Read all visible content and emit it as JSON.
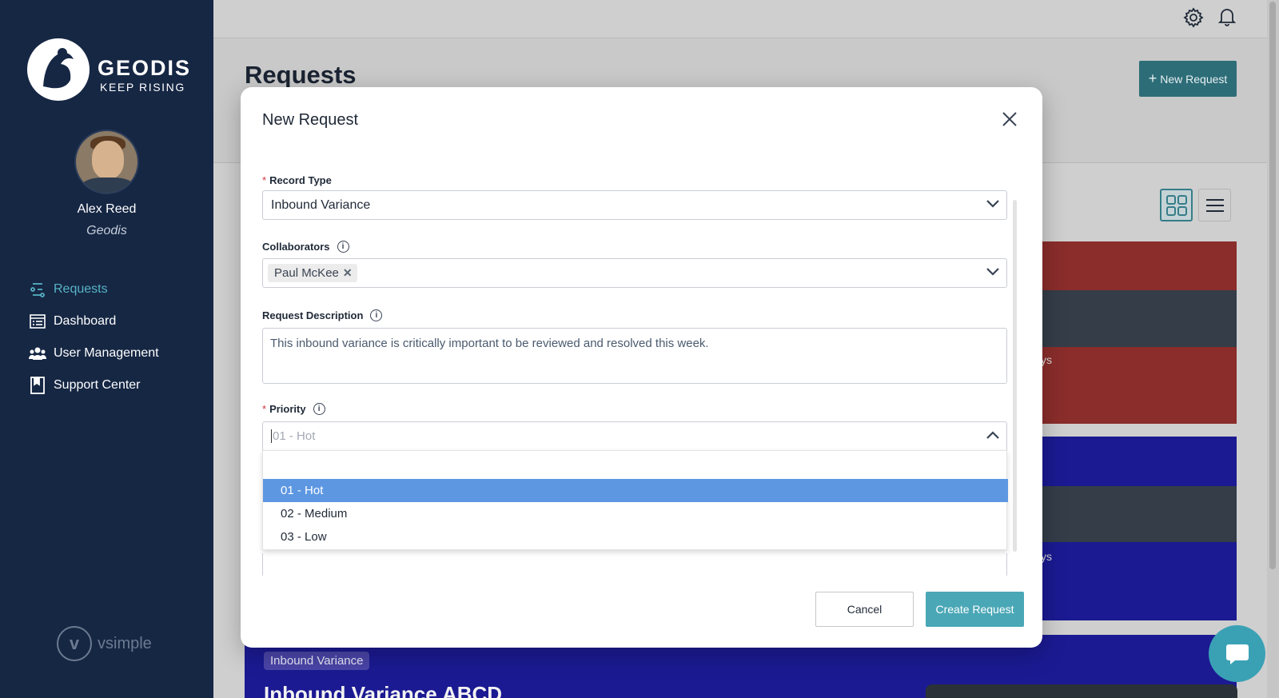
{
  "sidebar": {
    "brand": "GEODIS",
    "tagline": "KEEP RISING",
    "user_name": "Alex Reed",
    "user_org": "Geodis",
    "items": [
      {
        "label": "Requests",
        "icon": "requests-icon",
        "active": true
      },
      {
        "label": "Dashboard",
        "icon": "dashboard-icon",
        "active": false
      },
      {
        "label": "User Management",
        "icon": "users-icon",
        "active": false
      },
      {
        "label": "Support Center",
        "icon": "book-icon",
        "active": false
      }
    ],
    "footer_logo": "vsimple"
  },
  "page": {
    "title": "Requests",
    "new_request_label": "New Request",
    "card_fragment_1": "ys",
    "card_fragment_2": "ys",
    "bottom_card_badge": "Inbound Variance",
    "bottom_card_title": "Inbound Variance ABCD"
  },
  "modal": {
    "title": "New Request",
    "record_type": {
      "label": "Record Type",
      "value": "Inbound Variance"
    },
    "collaborators": {
      "label": "Collaborators",
      "chips": [
        "Paul McKee"
      ]
    },
    "description": {
      "label": "Request Description",
      "value": "This inbound variance is critically important to be reviewed and resolved this week."
    },
    "priority": {
      "label": "Priority",
      "placeholder": "01 - Hot",
      "options": [
        "01 - Hot",
        "02 - Medium",
        "03 - Low"
      ],
      "highlighted": "01 - Hot"
    },
    "cancel_label": "Cancel",
    "create_label": "Create Request"
  },
  "colors": {
    "sidebar_bg": "#162744",
    "accent": "#4aa7b6",
    "highlight": "#5d97e2"
  }
}
